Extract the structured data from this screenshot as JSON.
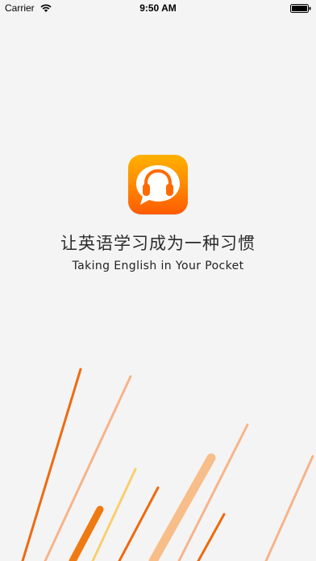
{
  "status_bar": {
    "carrier": "Carrier",
    "time": "9:50 AM",
    "wifi_icon": "wifi-icon",
    "battery_icon": "battery-icon"
  },
  "splash": {
    "app_icon": "headphones-chat-bubble-icon",
    "tagline_cn": "让英语学习成为一种习惯",
    "tagline_en": "Taking English in Your Pocket"
  },
  "colors": {
    "background": "#f4f4f4",
    "icon_gradient_top": "#ffb100",
    "icon_gradient_bottom": "#ff5a00",
    "stripe_dark_orange": "#ee6a10",
    "stripe_light_orange": "#f6b48a",
    "stripe_yellow": "#f9cf6e"
  }
}
